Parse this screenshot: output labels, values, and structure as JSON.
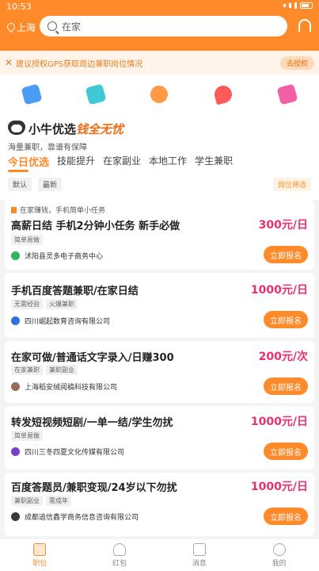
{
  "status": {
    "time": "10:53"
  },
  "header": {
    "location": "上海",
    "search_placeholder": "在家"
  },
  "gps_banner": {
    "text": "建议授权GPS获取周边兼职岗位情况",
    "button": "去授权"
  },
  "categories": [
    {
      "icon": "blue-shield-icon",
      "color": "#4a9df2"
    },
    {
      "icon": "cyan-card-icon",
      "color": "#3fc9d6"
    },
    {
      "icon": "orange-coin-icon",
      "color": "#ff9945"
    },
    {
      "icon": "red-fire-icon",
      "color": "#ff5a5a"
    },
    {
      "icon": "pink-note-icon",
      "color": "#f25fa4"
    }
  ],
  "brand": {
    "name": "小牛优选",
    "tag": "钱全无忧",
    "subtitle": "海量兼职，靠谱有保障"
  },
  "tabs": [
    "今日优选",
    "技能提升",
    "在家副业",
    "本地工作",
    "学生兼职"
  ],
  "filters": [
    "默认",
    "最新"
  ],
  "position_filter": "岗位筛选",
  "jobs": [
    {
      "notice": "在家赚钱，手机简单小任务",
      "title": "高薪日结 手机2分钟小任务 新手必做",
      "salary": "300元/日",
      "tags": [
        "简单易做"
      ],
      "company": "沭阳县灵多电子商务中心",
      "logo_color": "#2eb85c",
      "apply": "立即报名"
    },
    {
      "title": "手机百度答题兼职/在家日结",
      "salary": "1000元/日",
      "tags": [
        "无需经验",
        "火爆兼职"
      ],
      "company": "四川崛起数育咨询有限公司",
      "logo_color": "#2f6fe0",
      "apply": "立即报名"
    },
    {
      "title": "在家可做/普通话文字录入/日赚300",
      "salary": "200元/次",
      "tags": [
        "在家兼职",
        "兼职副业"
      ],
      "company": "上海稻安绒阅稿科技有限公司",
      "logo_color": "#9a6a5a",
      "apply": "立即报名"
    },
    {
      "title": "转发短视频短剧/一单一结/学生勿扰",
      "salary": "1000元/日",
      "tags": [
        "简单易做"
      ],
      "company": "四川三冬四夏文化传媒有限公司",
      "logo_color": "#7a3ec9",
      "apply": "立即报名"
    },
    {
      "title": "百度答题员/兼职变现/24岁以下勿扰",
      "salary": "1000元/日",
      "tags": [
        "兼职副业",
        "需成年"
      ],
      "company": "成都追信鑫学商务信息咨询有限公司",
      "logo_color": "#3a3a3a",
      "apply": "立即报名"
    }
  ],
  "bottom_nav": [
    "职位",
    "红包",
    "消息",
    "我的"
  ]
}
